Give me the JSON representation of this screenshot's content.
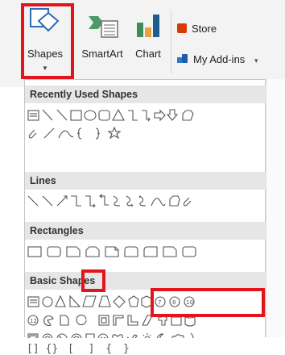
{
  "ribbon": {
    "shapes_label": "Shapes",
    "smartart_label": "SmartArt",
    "chart_label": "Chart",
    "store_label": "Store",
    "addins_label": "My Add-ins"
  },
  "gallery": {
    "sections": [
      "Recently Used Shapes",
      "Lines",
      "Rectangles",
      "Basic Shapes"
    ],
    "bracket_row": [
      "[",
      "]",
      "{",
      "}",
      "[",
      "]",
      "{",
      "}"
    ]
  },
  "colors": {
    "highlight": "#e3141b",
    "store_icon": "#d83b01",
    "addins_icon": "#2b79d0",
    "chart_orange": "#e8a33d"
  }
}
